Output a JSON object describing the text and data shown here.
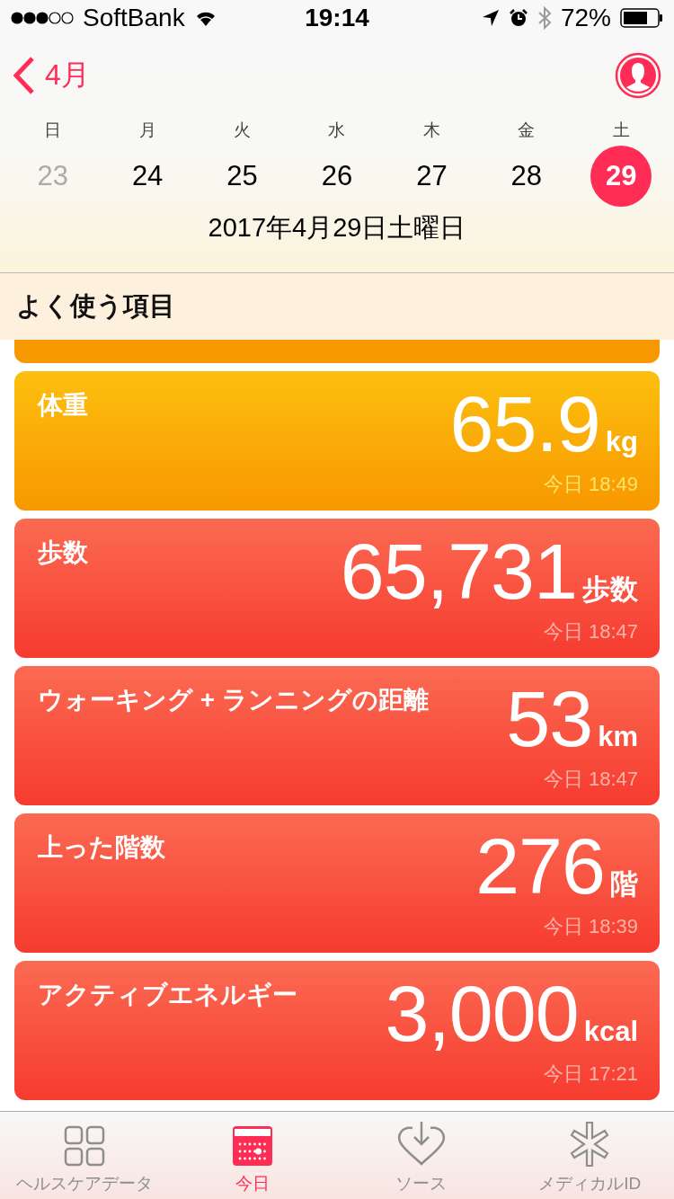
{
  "status_bar": {
    "carrier": "SoftBank",
    "time": "19:14",
    "battery_percent": "72%"
  },
  "nav": {
    "back_label": "4月"
  },
  "week": {
    "weekdays": [
      "日",
      "月",
      "火",
      "水",
      "木",
      "金",
      "土"
    ],
    "days": [
      {
        "label": "23",
        "selected": false,
        "dimmed": true
      },
      {
        "label": "24",
        "selected": false,
        "dimmed": false
      },
      {
        "label": "25",
        "selected": false,
        "dimmed": false
      },
      {
        "label": "26",
        "selected": false,
        "dimmed": false
      },
      {
        "label": "27",
        "selected": false,
        "dimmed": false
      },
      {
        "label": "28",
        "selected": false,
        "dimmed": false
      },
      {
        "label": "29",
        "selected": true,
        "dimmed": false
      }
    ],
    "date_title": "2017年4月29日土曜日"
  },
  "section_title": "よく使う項目",
  "cards": [
    {
      "kind": "weight",
      "clipped": true
    },
    {
      "kind": "weight",
      "clipped": false,
      "title": "体重",
      "value": "65.9",
      "unit": "kg",
      "time": "今日 18:49"
    },
    {
      "kind": "activity",
      "clipped": false,
      "title": "歩数",
      "value": "65,731",
      "unit": "歩数",
      "time": "今日 18:47"
    },
    {
      "kind": "activity",
      "clipped": false,
      "title": "ウォーキング + ランニングの距離",
      "value": "53",
      "unit": "km",
      "time": "今日 18:47"
    },
    {
      "kind": "activity",
      "clipped": false,
      "title": "上った階数",
      "value": "276",
      "unit": "階",
      "time": "今日 18:39"
    },
    {
      "kind": "activity",
      "clipped": false,
      "title": "アクティブエネルギー",
      "value": "3,000",
      "unit": "kcal",
      "time": "今日 17:21"
    }
  ],
  "tabs": [
    {
      "kind": "grid",
      "label": "ヘルスケアデータ",
      "selected": false
    },
    {
      "kind": "calendar",
      "label": "今日",
      "selected": true
    },
    {
      "kind": "heart",
      "label": "ソース",
      "selected": false
    },
    {
      "kind": "asterisk",
      "label": "メディカルID",
      "selected": false
    }
  ]
}
